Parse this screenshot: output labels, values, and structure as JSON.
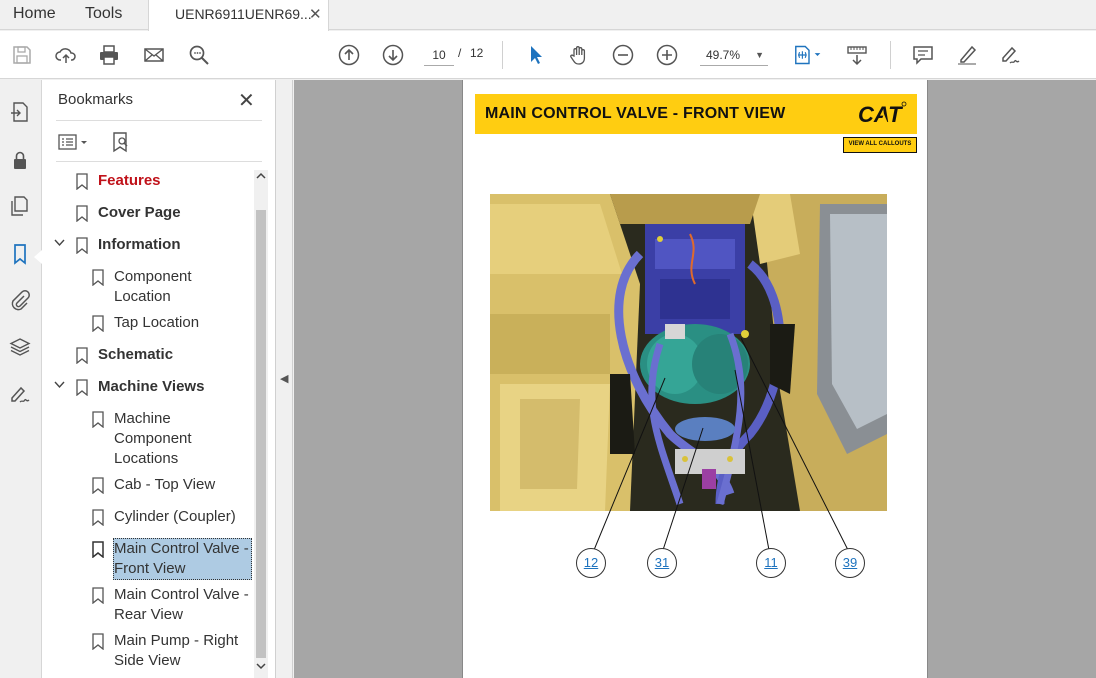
{
  "menu": {
    "home": "Home",
    "tools": "Tools"
  },
  "document_tab": {
    "title": "UENR6911UENR69...",
    "close": "✕"
  },
  "toolbar": {
    "current_page": "10",
    "page_separator": "/",
    "total_pages": "12",
    "zoom": "49.7%"
  },
  "bookmarks_panel": {
    "title": "Bookmarks",
    "items": [
      {
        "label": "Features",
        "style": "red"
      },
      {
        "label": "Cover Page",
        "style": "bold"
      },
      {
        "label": "Information",
        "style": "bold",
        "expanded": true
      },
      {
        "label": "Component",
        "label2": "Location",
        "style": "normal"
      },
      {
        "label": "Tap Location",
        "style": "normal"
      },
      {
        "label": "Schematic",
        "style": "bold"
      },
      {
        "label": "Machine Views",
        "style": "bold",
        "expanded": true
      },
      {
        "label": "Machine",
        "label2": "Component",
        "label3": "Locations",
        "style": "normal"
      },
      {
        "label": "Cab - Top View",
        "style": "normal"
      },
      {
        "label": "Cylinder (Coupler)",
        "style": "normal"
      },
      {
        "label": "Main Control Valve -",
        "label2": "Front View",
        "style": "selected"
      },
      {
        "label": "Main Control Valve -",
        "label2": "Rear View",
        "style": "normal"
      },
      {
        "label": "Main Pump - Right",
        "label2": "Side View",
        "style": "normal"
      }
    ]
  },
  "page": {
    "banner_title": "MAIN CONTROL VALVE - FRONT VIEW",
    "logo_text": "CAT",
    "callouts_button": "VIEW ALL CALLOUTS",
    "callouts": [
      "12",
      "31",
      "11",
      "39"
    ]
  },
  "colors": {
    "cat_yellow": "#ffcd11",
    "accent_blue": "#1e73be",
    "features_red": "#c0121a",
    "selection": "#aecbe3"
  }
}
